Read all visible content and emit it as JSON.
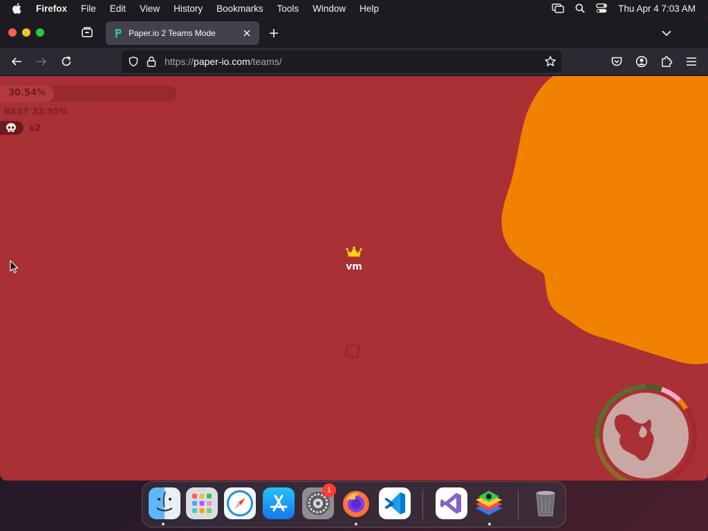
{
  "menubar": {
    "app_name": "Firefox",
    "menus": [
      "File",
      "Edit",
      "View",
      "History",
      "Bookmarks",
      "Tools",
      "Window",
      "Help"
    ],
    "clock": "Thu Apr 4  7:03 AM"
  },
  "browser": {
    "tab_title": "Paper.io 2 Teams Mode",
    "url_scheme": "https://",
    "url_domain": "paper-io.com",
    "url_path": "/teams/"
  },
  "game": {
    "territory_percent": "30.54%",
    "territory_fraction": 0.3054,
    "best_score": "BEST 32.95%",
    "kills": "x2",
    "player_name": "vm",
    "colors": {
      "own_territory": "#a93035",
      "enemy_territory": "#f28100",
      "minimap_bg": "#c9a7a3"
    }
  },
  "dock": {
    "apps": [
      "finder-icon",
      "launchpad-icon",
      "safari-icon",
      "app-store-icon",
      "system-settings-icon",
      "firefox-icon",
      "vscode-icon",
      "visual-studio-icon",
      "bluestacks-icon",
      "trash-icon"
    ],
    "settings_badge": "1"
  }
}
